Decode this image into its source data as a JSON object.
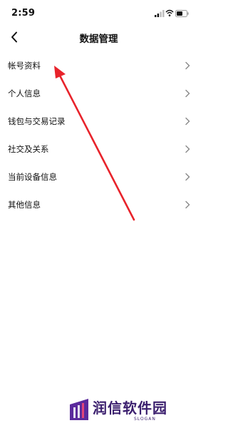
{
  "status_bar": {
    "time": "2:59",
    "icons": [
      "signal-icon",
      "wifi-icon",
      "battery-icon"
    ]
  },
  "header": {
    "title": "数据管理",
    "back_icon": "chevron-left-icon"
  },
  "menu": {
    "items": [
      {
        "label": "帐号资料"
      },
      {
        "label": "个人信息"
      },
      {
        "label": "钱包与交易记录"
      },
      {
        "label": "社交及关系"
      },
      {
        "label": "当前设备信息"
      },
      {
        "label": "其他信息"
      }
    ],
    "chevron_icon": "chevron-right-icon"
  },
  "annotation": {
    "type": "red-arrow",
    "points_to": "帐号资料",
    "color": "#e8232b"
  },
  "watermark": {
    "name": "润信软件园",
    "slogan": "SLOGAN",
    "color": "#3b1f6e"
  }
}
